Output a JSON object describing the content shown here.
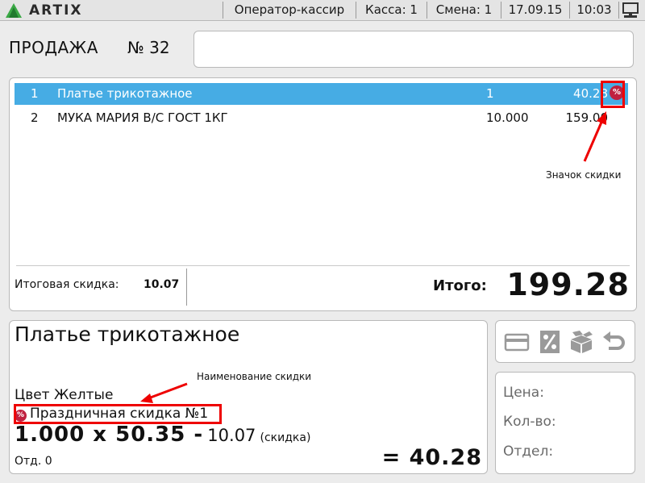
{
  "topbar": {
    "logo_text": "ARTIX",
    "role": "Оператор-кассир",
    "cash_register": "Касса: 1",
    "shift": "Смена: 1",
    "date": "17.09.15",
    "time": "10:03",
    "logo_icon": "artix-logo-icon",
    "status_icon": "monitor-icon"
  },
  "sale": {
    "title": "ПРОДАЖА",
    "number": "№ 32",
    "search_value": ""
  },
  "receipt": {
    "rows": [
      {
        "idx": "1",
        "name": "Платье трикотажное",
        "qty": "1",
        "price": "40.28",
        "has_discount": true,
        "selected": true
      },
      {
        "idx": "2",
        "name": "МУКА МАРИЯ В/С ГОСТ 1КГ",
        "qty": "10.000",
        "price": "159.00",
        "has_discount": false,
        "selected": false
      }
    ],
    "discount_icon_text": "%",
    "total_discount_label": "Итоговая скидка:",
    "total_discount_value": "10.07",
    "total_label": "Итого:",
    "total_value": "199.28"
  },
  "annotations": {
    "discount_icon_note": "Значок скидки",
    "discount_name_note": "Наименование скидки"
  },
  "detail": {
    "name": "Платье трикотажное",
    "attribute": "Цвет  Желтые",
    "discount_name": "Праздничная скидка №1",
    "qty_price": "1.000 x 50.35 -",
    "discount_amount": "10.07",
    "discount_suffix": "(скидка)",
    "department": "Отд. 0",
    "sum": "= 40.28"
  },
  "tools": {
    "icons": [
      "credit-card-icon",
      "percent-discount-icon",
      "boxes-icon",
      "return-arrow-icon"
    ]
  },
  "info": {
    "price_label": "Цена:",
    "qty_label": "Кол-во:",
    "dept_label": "Отдел:"
  },
  "colors": {
    "selected_row": "#46ace4",
    "discount_badge": "#c0203f",
    "annotation": "#ee0000"
  }
}
